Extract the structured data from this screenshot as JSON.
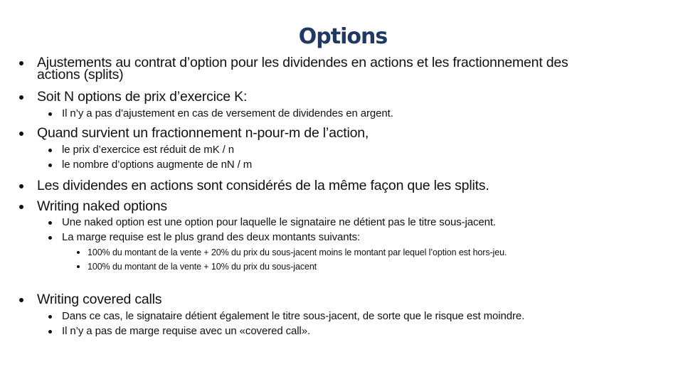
{
  "slide": {
    "title": "Options",
    "colors": {
      "title": "#1f3864",
      "text": "#111111",
      "background": "#ffffff"
    },
    "bullets": [
      {
        "level": 1,
        "text": "Ajustements au contrat d’option pour les dividendes en actions et les fractionnement des",
        "continuation": "actions (splits)"
      },
      {
        "level": 1,
        "text": "Soit N options de prix d’exercice K:",
        "children": [
          {
            "level": 2,
            "text": "Il n’y a pas d’ajustement en cas de versement de dividendes en argent."
          }
        ]
      },
      {
        "level": 1,
        "text": "Quand survient un fractionnement n-pour-m de l’action,",
        "children": [
          {
            "level": 2,
            "text": "le prix d’exercice est réduit de mK / n"
          },
          {
            "level": 2,
            "text": "le nombre d’options augmente de nN / m"
          }
        ]
      },
      {
        "level": 1,
        "text": "Les dividendes en actions sont considérés de la même façon que les splits."
      },
      {
        "level": 1,
        "text": "Writing naked options",
        "children": [
          {
            "level": 2,
            "text": "Une naked option est une option pour laquelle le signataire ne détient pas le titre sous-jacent."
          },
          {
            "level": 2,
            "text": "La marge requise est le plus grand des deux montants suivants:",
            "children": [
              {
                "level": 3,
                "text": "100% du montant de la vente + 20% du prix du sous-jacent moins le montant par lequel l’option est hors-jeu."
              },
              {
                "level": 3,
                "text": "100% du montant de la vente + 10% du prix du sous-jacent"
              }
            ]
          }
        ]
      },
      {
        "level": 1,
        "text": "Writing covered calls",
        "children": [
          {
            "level": 2,
            "text": "Dans ce cas, le signataire détient également le titre sous-jacent, de sorte que le risque est moindre."
          },
          {
            "level": 2,
            "text": "Il n’y a pas de marge requise avec un «covered call»."
          }
        ]
      }
    ]
  }
}
